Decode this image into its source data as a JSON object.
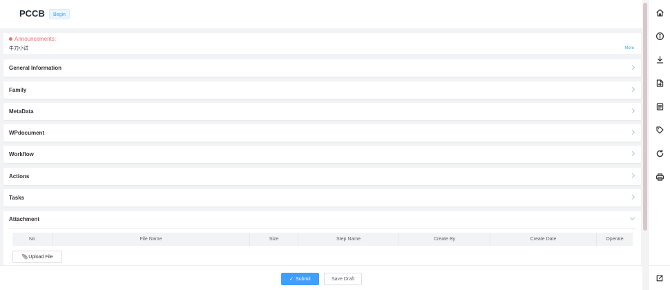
{
  "header": {
    "title": "PCCB",
    "badge": "Begin"
  },
  "announcement": {
    "label": "Announcements:",
    "text": "牛刀小试",
    "more": "More"
  },
  "sections": [
    {
      "label": "General Information"
    },
    {
      "label": "Family"
    },
    {
      "label": "MetaData"
    },
    {
      "label": "WPdocument"
    },
    {
      "label": "Workflow"
    },
    {
      "label": "Actions"
    },
    {
      "label": "Tasks"
    }
  ],
  "attachment": {
    "label": "Attachment",
    "columns": [
      "No",
      "File Name",
      "Size",
      "Step Name",
      "Create By",
      "Create Date",
      "Operate"
    ],
    "upload_label": "Upload File"
  },
  "footer": {
    "submit_label": "Submit",
    "draft_label": "Save Draft"
  },
  "rail_icons": [
    "home-icon",
    "info-icon",
    "download-icon",
    "export-doc-icon",
    "document-icon",
    "tag-icon",
    "refresh-icon",
    "print-icon",
    "open-external-icon"
  ],
  "colors": {
    "accent": "#409eff",
    "alert": "#f56c6c",
    "background": "#f2f3f5"
  }
}
